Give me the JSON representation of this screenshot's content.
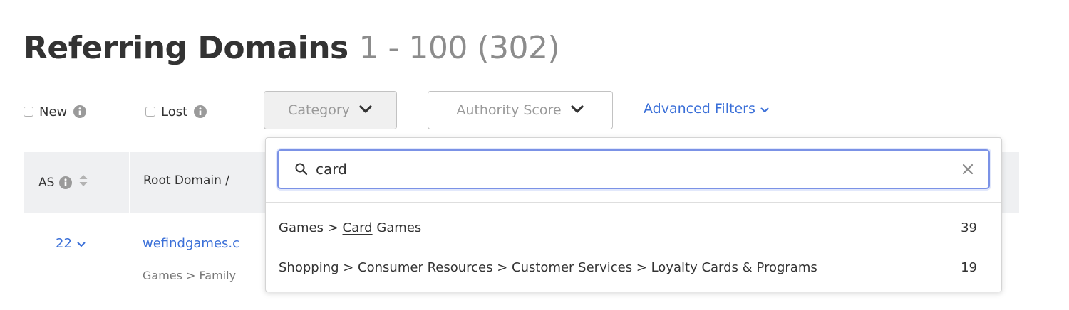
{
  "page": {
    "title": "Referring Domains",
    "range": "1 - 100 (302)"
  },
  "filters": {
    "new_label": "New",
    "lost_label": "Lost",
    "category_label": "Category",
    "authority_label": "Authority Score",
    "advanced_label": "Advanced Filters"
  },
  "table": {
    "headers": {
      "as": "AS",
      "root_domain": "Root Domain /"
    },
    "rows": [
      {
        "as": "22",
        "domain": "wefindgames.c",
        "category": "Games > Family"
      }
    ]
  },
  "dropdown": {
    "search_value": "card",
    "options": [
      {
        "pre": "Games > ",
        "match": "Card",
        "post": " Games",
        "count": "39"
      },
      {
        "pre": "Shopping > Consumer Resources > Customer Services > Loyalty ",
        "match": "Card",
        "post": "s & Programs",
        "count": "19"
      }
    ]
  },
  "colors": {
    "link": "#3a6fd8",
    "header_bg": "#eff0f2",
    "focus_border": "#7b92e6",
    "info_icon": "#9a9a9a"
  },
  "icons": [
    "info-icon",
    "chevron-down-icon",
    "sort-icon",
    "search-icon",
    "clear-icon"
  ]
}
